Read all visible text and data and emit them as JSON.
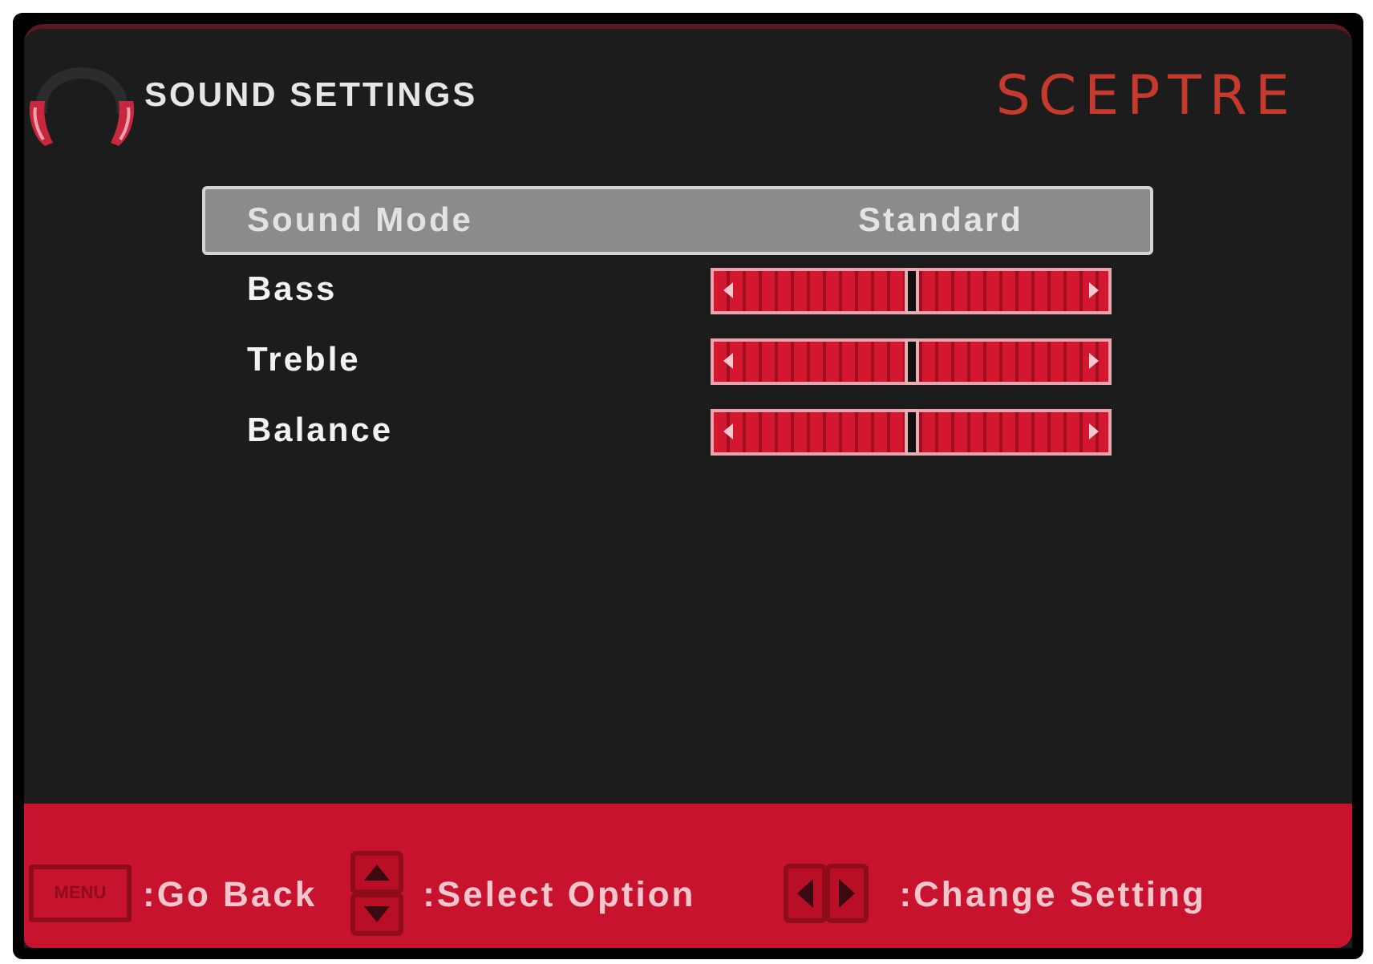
{
  "header": {
    "title": "SOUND SETTINGS",
    "brand": "SCEPTRE"
  },
  "items": [
    {
      "kind": "option",
      "label": "Sound Mode",
      "value": "Standard",
      "selected": true
    },
    {
      "kind": "slider",
      "label": "Bass",
      "level": 0.5,
      "selected": false
    },
    {
      "kind": "slider",
      "label": "Treble",
      "level": 0.5,
      "selected": false
    },
    {
      "kind": "slider",
      "label": "Balance",
      "level": 0.5,
      "selected": false
    }
  ],
  "footer": [
    {
      "kind": "menu",
      "key": "MENU",
      "label": ":Go Back"
    },
    {
      "kind": "updown",
      "label": ":Select Option"
    },
    {
      "kind": "leftright",
      "label": ":Change Setting"
    }
  ]
}
